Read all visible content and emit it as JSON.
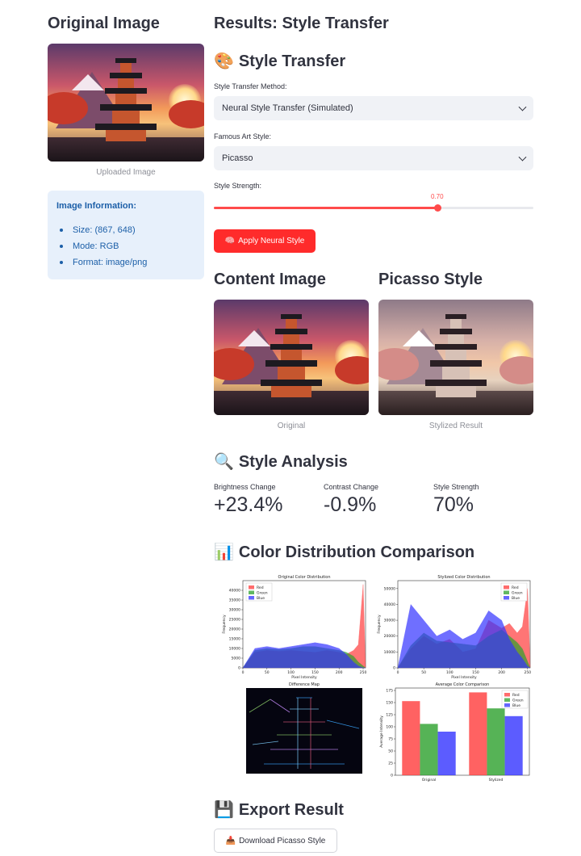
{
  "left": {
    "title": "Original Image",
    "image_caption": "Uploaded Image",
    "info": {
      "title": "Image Information:",
      "items": [
        "Size: (867, 648)",
        "Mode: RGB",
        "Format: image/png"
      ]
    }
  },
  "main": {
    "title": "Results: Style Transfer",
    "section_style": {
      "icon": "palette-icon",
      "emoji": "🎨",
      "title": "Style Transfer"
    },
    "method": {
      "label": "Style Transfer Method:",
      "value": "Neural Style Transfer (Simulated)"
    },
    "art_style": {
      "label": "Famous Art Style:",
      "value": "Picasso"
    },
    "strength": {
      "label": "Style Strength:",
      "value": "0.70",
      "fraction": 0.7
    },
    "apply_button": {
      "icon": "brain-icon",
      "emoji": "🧠",
      "label": "Apply Neural Style"
    },
    "content_image": {
      "title": "Content Image",
      "caption": "Original"
    },
    "styled_image": {
      "title": "Picasso Style",
      "caption": "Stylized Result"
    },
    "analysis": {
      "icon": "magnifier-icon",
      "emoji": "🔍",
      "title": "Style Analysis",
      "metrics": [
        {
          "label": "Brightness Change",
          "value": "+23.4%"
        },
        {
          "label": "Contrast Change",
          "value": "-0.9%"
        },
        {
          "label": "Style Strength",
          "value": "70%"
        }
      ]
    },
    "color_section": {
      "icon": "bar-chart-icon",
      "emoji": "📊",
      "title": "Color Distribution Comparison"
    },
    "export": {
      "icon": "floppy-icon",
      "emoji": "💾",
      "title": "Export Result",
      "button": {
        "icon": "inbox-tray-icon",
        "emoji": "📥",
        "label": "Download Picasso Style"
      }
    }
  },
  "colors": {
    "accent": "#ff4b4b",
    "info_bg": "#e7f0fb",
    "info_text": "#1c5fa8",
    "red": "#ff3b3b",
    "green": "#2ca02c",
    "blue": "#3333ff"
  },
  "chart_data": [
    {
      "type": "area",
      "title": "Original Color Distribution",
      "xlabel": "Pixel Intensity",
      "ylabel": "Frequency",
      "xlim": [
        0,
        255
      ],
      "ylim": [
        0,
        45000
      ],
      "yticks": [
        0,
        5000,
        10000,
        15000,
        20000,
        25000,
        30000,
        35000,
        40000
      ],
      "xticks": [
        0,
        50,
        100,
        150,
        200,
        250
      ],
      "legend": [
        "Red",
        "Green",
        "Blue"
      ],
      "legend_position": "top-left",
      "series": [
        {
          "name": "Red",
          "x": [
            0,
            25,
            50,
            75,
            100,
            125,
            150,
            175,
            200,
            215,
            230,
            240,
            250,
            255
          ],
          "values": [
            0,
            8000,
            9000,
            8500,
            9000,
            8500,
            8000,
            9000,
            8000,
            7000,
            9000,
            12000,
            43000,
            0
          ]
        },
        {
          "name": "Green",
          "x": [
            0,
            25,
            50,
            75,
            100,
            125,
            150,
            175,
            200,
            215,
            230,
            240,
            250,
            255
          ],
          "values": [
            0,
            9000,
            10000,
            9500,
            10000,
            11000,
            11000,
            10000,
            9000,
            8000,
            6000,
            3000,
            1000,
            0
          ]
        },
        {
          "name": "Blue",
          "x": [
            0,
            25,
            50,
            75,
            100,
            125,
            150,
            175,
            200,
            215,
            230,
            240,
            250,
            255
          ],
          "values": [
            0,
            10000,
            11000,
            10000,
            11000,
            12000,
            13000,
            12000,
            10000,
            7000,
            3000,
            1000,
            0,
            0
          ]
        }
      ]
    },
    {
      "type": "area",
      "title": "Stylized Color Distribution",
      "xlabel": "Pixel Intensity",
      "ylabel": "Frequency",
      "xlim": [
        0,
        255
      ],
      "ylim": [
        0,
        55000
      ],
      "yticks": [
        0,
        10000,
        20000,
        30000,
        40000,
        50000
      ],
      "xticks": [
        0,
        50,
        100,
        150,
        200,
        250
      ],
      "legend": [
        "Red",
        "Green",
        "Blue"
      ],
      "legend_position": "top-right",
      "series": [
        {
          "name": "Red",
          "x": [
            0,
            25,
            50,
            75,
            100,
            125,
            150,
            175,
            200,
            215,
            230,
            240,
            250,
            255
          ],
          "values": [
            0,
            12000,
            20000,
            15000,
            18000,
            10000,
            12000,
            30000,
            25000,
            28000,
            22000,
            26000,
            50000,
            0
          ]
        },
        {
          "name": "Green",
          "x": [
            0,
            25,
            50,
            75,
            100,
            125,
            150,
            175,
            200,
            215,
            230,
            240,
            250,
            255
          ],
          "values": [
            0,
            14000,
            22000,
            17000,
            16000,
            15000,
            14000,
            20000,
            24000,
            20000,
            16000,
            12000,
            4000,
            0
          ]
        },
        {
          "name": "Blue",
          "x": [
            0,
            25,
            50,
            75,
            100,
            125,
            150,
            175,
            200,
            215,
            230,
            240,
            250,
            255
          ],
          "values": [
            0,
            40000,
            30000,
            20000,
            24000,
            18000,
            22000,
            36000,
            30000,
            18000,
            10000,
            6000,
            1000,
            0
          ]
        }
      ]
    },
    {
      "type": "heatmap",
      "title": "Difference Map"
    },
    {
      "type": "bar",
      "title": "Average Color Comparison",
      "ylabel": "Average Intensity",
      "categories": [
        "Original",
        "Stylized"
      ],
      "ylim": [
        0,
        180
      ],
      "yticks": [
        0,
        25,
        50,
        75,
        100,
        125,
        150,
        175
      ],
      "legend": [
        "Red",
        "Green",
        "Blue"
      ],
      "legend_position": "top-right",
      "series": [
        {
          "name": "Red",
          "values": [
            153,
            171
          ]
        },
        {
          "name": "Green",
          "values": [
            106,
            138
          ]
        },
        {
          "name": "Blue",
          "values": [
            90,
            122
          ]
        }
      ]
    }
  ]
}
